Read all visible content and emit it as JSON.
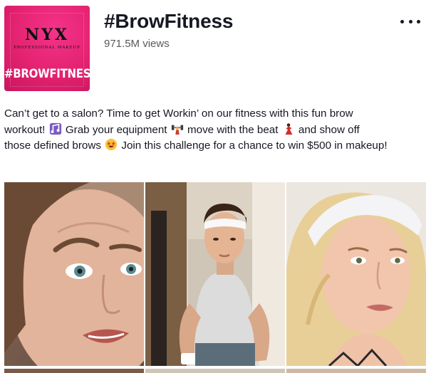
{
  "challenge": {
    "cover": {
      "logo_text": "NYX",
      "logo_subtext": "PROFESSIONAL MAKEUP",
      "hashtag_text": "#BROWFITNESS"
    },
    "title": "#BrowFitness",
    "views": "971.5M views",
    "more_icon": "more-dots-icon",
    "description": {
      "part1": "Can’t get to a salon? Time to get Workin’ on our fitness with this fun brow workout! ",
      "part2": " Grab your equipment ",
      "part3": " move with the beat ",
      "part4": " and show off those defined brows ",
      "part5": " Join this challenge for a chance to win $500 in makeup!"
    },
    "emoji_icons": [
      "music-notes-emoji",
      "weightlifter-emoji",
      "dancer-emoji",
      "star-struck-emoji"
    ]
  },
  "videos": [
    {
      "thumbnail": "woman-raising-eyebrow"
    },
    {
      "thumbnail": "man-with-headband"
    },
    {
      "thumbnail": "blonde-woman-with-headband"
    }
  ],
  "colors": {
    "brand_pink": "#e3226f",
    "text_primary": "#161823",
    "text_secondary": "#5a5a5f"
  }
}
